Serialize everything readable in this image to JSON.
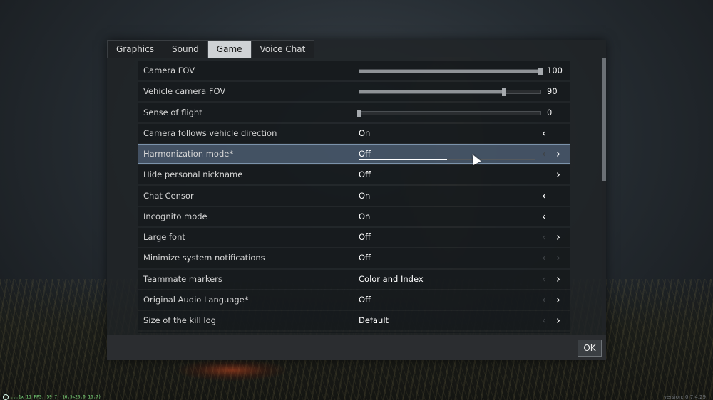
{
  "tabs": [
    {
      "label": "Graphics",
      "active": false
    },
    {
      "label": "Sound",
      "active": false
    },
    {
      "label": "Game",
      "active": true
    },
    {
      "label": "Voice Chat",
      "active": false
    }
  ],
  "settings": {
    "camera_fov": {
      "label": "Camera FOV",
      "value": "100",
      "level": 1.0
    },
    "vehicle_camera_fov": {
      "label": "Vehicle camera FOV",
      "value": "90",
      "level": 0.8
    },
    "sense_of_flight": {
      "label": "Sense of flight",
      "value": "0",
      "level": 0.0
    },
    "camera_follows": {
      "label": "Camera follows vehicle direction",
      "value": "On"
    },
    "harmonization_mode": {
      "label": "Harmonization mode*",
      "value": "Off",
      "progress": 0.5
    },
    "hide_nickname": {
      "label": "Hide personal nickname",
      "value": "Off"
    },
    "chat_censor": {
      "label": "Chat Censor",
      "value": "On"
    },
    "incognito": {
      "label": "Incognito mode",
      "value": "On"
    },
    "large_font": {
      "label": "Large font",
      "value": "Off"
    },
    "minimize_notifications": {
      "label": "Minimize system notifications",
      "value": "Off"
    },
    "teammate_markers": {
      "label": "Teammate markers",
      "value": "Color and Index"
    },
    "audio_language": {
      "label": "Original Audio Language*",
      "value": "Off"
    },
    "kill_log_size": {
      "label": "Size of the kill log",
      "value": "Default"
    }
  },
  "arrows": {
    "left": "‹",
    "right": "›"
  },
  "footer": {
    "ok_label": "OK"
  },
  "overlay": {
    "fps": "...1x 11 FPS: 59.7 (16.5<20.0 16.7)",
    "version": "version: 0.7.4.29"
  }
}
